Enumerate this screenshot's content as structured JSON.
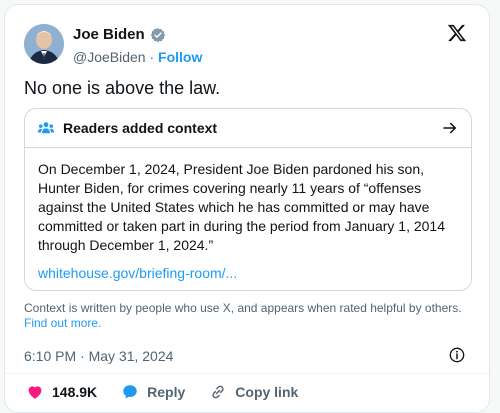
{
  "author": {
    "name": "Joe Biden",
    "handle": "@JoeBiden",
    "separator": "·",
    "follow_label": "Follow",
    "badge_icon": "verified-badge-icon"
  },
  "logo_icon": "x-logo-icon",
  "tweet_text": "No one is above the law.",
  "note": {
    "title": "Readers added context",
    "body": "On December 1, 2024, President Joe Biden pardoned his son, Hunter Biden, for crimes covering nearly 11 years of “offenses against the United States which he has committed or may have committed or taken part in during the period from January 1, 2014 through December 1, 2024.”",
    "link": "whitehouse.gov/briefing-room/..."
  },
  "footnote": {
    "text": "Context is written by people who use X, and appears when rated helpful by others.",
    "link": "Find out more."
  },
  "timestamp": "6:10 PM · May 31, 2024",
  "actions": {
    "likes": "148.9K",
    "reply": "Reply",
    "copy": "Copy link"
  },
  "colors": {
    "accent": "#1d9bf0",
    "like": "#f91880",
    "text": "#0f1419",
    "muted": "#536471"
  }
}
